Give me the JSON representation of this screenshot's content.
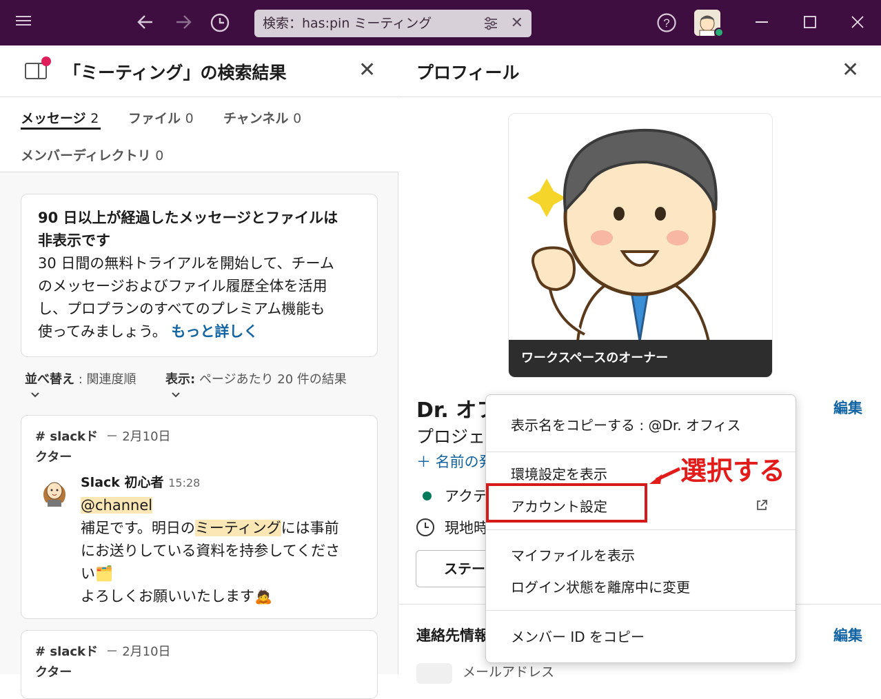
{
  "titlebar": {
    "search_text": "検索：has:pin ミーティング"
  },
  "left_panel": {
    "title": "「ミーティング」の検索結果",
    "tabs": [
      {
        "label": "メッセージ",
        "count": "2"
      },
      {
        "label": "ファイル",
        "count": "0"
      },
      {
        "label": "チャンネル",
        "count": "0"
      },
      {
        "label": "メンバーディレクトリ",
        "count": "0"
      }
    ],
    "notice": {
      "heading_line1": "90 日以上が経過したメッセージとファイルは",
      "heading_line2": "非表示です",
      "body_line1": "30 日間の無料トライアルを開始して、チーム",
      "body_line2": "のメッセージおよびファイル履歴全体を活用",
      "body_line3": "し、プロプランのすべてのプレミアム機能も",
      "body_line4": "使ってみましょう。",
      "link": "もっと詳しく"
    },
    "sort": {
      "label": "並べ替え",
      "value": ": 関連度順"
    },
    "display": {
      "label": "表示:",
      "value": "ページあたり 20 件の結果"
    },
    "results": [
      {
        "channel": "# slackド",
        "channel_cont": "クター",
        "date": "－ 2月10日",
        "author": "Slack 初心者",
        "time": "15:28",
        "mention": "@channel",
        "line1_pre": "補足です。明日の",
        "line1_hl": "ミーティング",
        "line1_post": "には事前",
        "line2": "にお送りしている資料を持参してくださ",
        "line3": "い🗂️",
        "line4": "よろしくお願いいたします🙇"
      },
      {
        "channel": "# slackド",
        "channel_cont": "クター",
        "date": "－ 2月10日"
      }
    ]
  },
  "right_panel": {
    "title": "プロフィール",
    "photo_banner": "ワークスペースのオーナー",
    "name": "Dr. オフ",
    "role": "プロジェ",
    "add_name": "＋ 名前の発",
    "edit": "編集",
    "status_active": "アクテ",
    "local_time": "現地時",
    "status_button": "ステー",
    "contact_title": "連絡先情報",
    "contact_edit": "編集",
    "email_label": "メールアドレス"
  },
  "context_menu": {
    "items": [
      "表示名をコピーする : @Dr. オフィス",
      "環境設定を表示",
      "アカウント設定",
      "マイファイルを表示",
      "ログイン状態を離席中に変更",
      "メンバー ID をコピー"
    ]
  },
  "annotation": {
    "text": "選択する",
    "color": "#e21b1b"
  },
  "colors": {
    "titlebar": "#3f0e40",
    "link": "#1264a3",
    "highlight": "#fbe7b6",
    "presence": "#2bac76"
  }
}
